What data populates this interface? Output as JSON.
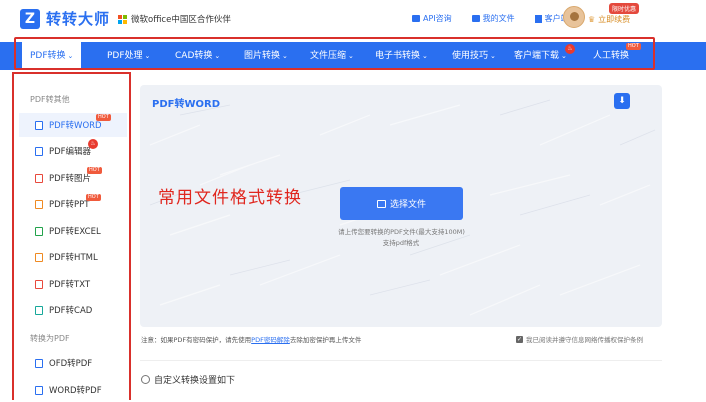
{
  "header": {
    "logo_mark": "Z",
    "logo_text": "转转大师",
    "partner": "微软office中国区合作伙伴",
    "links": [
      {
        "label": "API咨询",
        "icon": "chat-icon"
      },
      {
        "label": "我的文件",
        "icon": "folder-icon"
      },
      {
        "label": "客户端",
        "icon": "download-icon"
      }
    ],
    "vip_label": "立即续费",
    "vip_badge": "限时优惠"
  },
  "nav": {
    "items": [
      {
        "label": "PDF转换",
        "active": true
      },
      {
        "label": "PDF处理"
      },
      {
        "label": "CAD转换"
      },
      {
        "label": "图片转换"
      },
      {
        "label": "文件压缩"
      },
      {
        "label": "电子书转换"
      },
      {
        "label": "使用技巧"
      },
      {
        "label": "客户端下载"
      },
      {
        "label": "人工转换",
        "badge": "HOT"
      }
    ]
  },
  "sidebar": {
    "group1": "PDF转其他",
    "items1": [
      {
        "label": "PDF转WORD",
        "badge": "HOT"
      },
      {
        "label": "PDF编辑器"
      },
      {
        "label": "PDF转图片",
        "badge": "HOT"
      },
      {
        "label": "PDF转PPT",
        "badge": "HOT"
      },
      {
        "label": "PDF转EXCEL"
      },
      {
        "label": "PDF转HTML"
      },
      {
        "label": "PDF转TXT"
      },
      {
        "label": "PDF转CAD"
      }
    ],
    "group2": "转换为PDF",
    "items2": [
      {
        "label": "OFD转PDF"
      },
      {
        "label": "WORD转PDF"
      }
    ]
  },
  "main": {
    "title": "PDF转WORD",
    "overlay": "常用文件格式转换",
    "choose_button": "选择文件",
    "hint1": "请上传您要转换的PDF文件(最大支持100M)",
    "hint2": "支持pdf格式",
    "note_prefix": "注意：如果PDF有密码保护，请先使用",
    "note_link": "PDF密码解除",
    "note_suffix": "去除加密保护再上传文件",
    "agree": "我已阅读并遵守信息网络传播权保护条例",
    "custom": "自定义转换设置如下"
  },
  "colors": {
    "primary": "#2a6ff0",
    "highlight_red": "#d9302b",
    "hot": "#f05a3c"
  }
}
